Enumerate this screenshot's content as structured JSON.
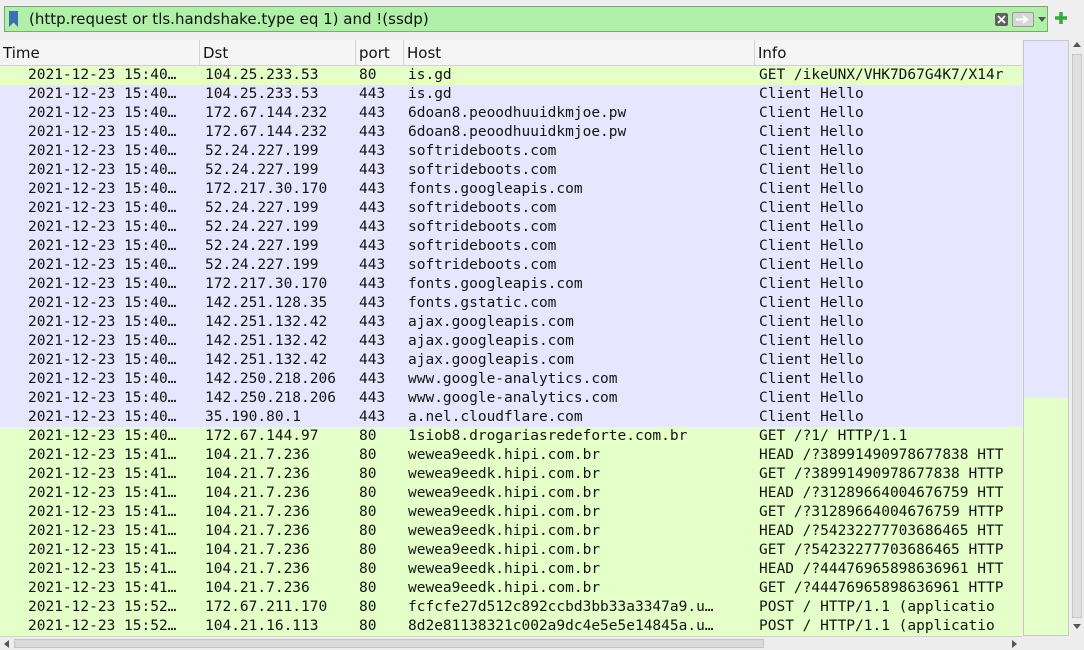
{
  "filter": {
    "text": "(http.request or tls.handshake.type eq 1) and !(ssdp)",
    "bg_color": "#b0f0a8"
  },
  "icons": {
    "bookmark": "bookmark-icon",
    "clear": "clear-icon",
    "apply": "apply-arrow-icon",
    "dropdown": "chevron-down-icon",
    "add": "plus-icon"
  },
  "colors": {
    "http_row": "#e4ffc7",
    "tls_row": "#e7e6ff"
  },
  "columns": [
    "Time",
    "Dst",
    "port",
    "Host",
    "Info"
  ],
  "rows": [
    {
      "time": "2021-12-23 15:40…",
      "dst": "104.25.233.53",
      "port": "80",
      "host": "is.gd",
      "info": "GET /ikeUNX/VHK7D67G4K7/X14r",
      "type": "http"
    },
    {
      "time": "2021-12-23 15:40…",
      "dst": "104.25.233.53",
      "port": "443",
      "host": "is.gd",
      "info": "Client Hello",
      "type": "tls"
    },
    {
      "time": "2021-12-23 15:40…",
      "dst": "172.67.144.232",
      "port": "443",
      "host": "6doan8.peoodhuuidkmjoe.pw",
      "info": "Client Hello",
      "type": "tls"
    },
    {
      "time": "2021-12-23 15:40…",
      "dst": "172.67.144.232",
      "port": "443",
      "host": "6doan8.peoodhuuidkmjoe.pw",
      "info": "Client Hello",
      "type": "tls"
    },
    {
      "time": "2021-12-23 15:40…",
      "dst": "52.24.227.199",
      "port": "443",
      "host": "softrideboots.com",
      "info": "Client Hello",
      "type": "tls"
    },
    {
      "time": "2021-12-23 15:40…",
      "dst": "52.24.227.199",
      "port": "443",
      "host": "softrideboots.com",
      "info": "Client Hello",
      "type": "tls"
    },
    {
      "time": "2021-12-23 15:40…",
      "dst": "172.217.30.170",
      "port": "443",
      "host": "fonts.googleapis.com",
      "info": "Client Hello",
      "type": "tls"
    },
    {
      "time": "2021-12-23 15:40…",
      "dst": "52.24.227.199",
      "port": "443",
      "host": "softrideboots.com",
      "info": "Client Hello",
      "type": "tls"
    },
    {
      "time": "2021-12-23 15:40…",
      "dst": "52.24.227.199",
      "port": "443",
      "host": "softrideboots.com",
      "info": "Client Hello",
      "type": "tls"
    },
    {
      "time": "2021-12-23 15:40…",
      "dst": "52.24.227.199",
      "port": "443",
      "host": "softrideboots.com",
      "info": "Client Hello",
      "type": "tls"
    },
    {
      "time": "2021-12-23 15:40…",
      "dst": "52.24.227.199",
      "port": "443",
      "host": "softrideboots.com",
      "info": "Client Hello",
      "type": "tls"
    },
    {
      "time": "2021-12-23 15:40…",
      "dst": "172.217.30.170",
      "port": "443",
      "host": "fonts.googleapis.com",
      "info": "Client Hello",
      "type": "tls"
    },
    {
      "time": "2021-12-23 15:40…",
      "dst": "142.251.128.35",
      "port": "443",
      "host": "fonts.gstatic.com",
      "info": "Client Hello",
      "type": "tls"
    },
    {
      "time": "2021-12-23 15:40…",
      "dst": "142.251.132.42",
      "port": "443",
      "host": "ajax.googleapis.com",
      "info": "Client Hello",
      "type": "tls"
    },
    {
      "time": "2021-12-23 15:40…",
      "dst": "142.251.132.42",
      "port": "443",
      "host": "ajax.googleapis.com",
      "info": "Client Hello",
      "type": "tls"
    },
    {
      "time": "2021-12-23 15:40…",
      "dst": "142.251.132.42",
      "port": "443",
      "host": "ajax.googleapis.com",
      "info": "Client Hello",
      "type": "tls"
    },
    {
      "time": "2021-12-23 15:40…",
      "dst": "142.250.218.206",
      "port": "443",
      "host": "www.google-analytics.com",
      "info": "Client Hello",
      "type": "tls"
    },
    {
      "time": "2021-12-23 15:40…",
      "dst": "142.250.218.206",
      "port": "443",
      "host": "www.google-analytics.com",
      "info": "Client Hello",
      "type": "tls"
    },
    {
      "time": "2021-12-23 15:40…",
      "dst": "35.190.80.1",
      "port": "443",
      "host": "a.nel.cloudflare.com",
      "info": "Client Hello",
      "type": "tls"
    },
    {
      "time": "2021-12-23 15:40…",
      "dst": "172.67.144.97",
      "port": "80",
      "host": "1siob8.drogariasredeforte.com.br",
      "info": "GET /?1/ HTTP/1.1",
      "type": "http"
    },
    {
      "time": "2021-12-23 15:41…",
      "dst": "104.21.7.236",
      "port": "80",
      "host": "wewea9eedk.hipi.com.br",
      "info": "HEAD /?38991490978677838 HTT",
      "type": "http"
    },
    {
      "time": "2021-12-23 15:41…",
      "dst": "104.21.7.236",
      "port": "80",
      "host": "wewea9eedk.hipi.com.br",
      "info": "GET /?38991490978677838 HTTP",
      "type": "http"
    },
    {
      "time": "2021-12-23 15:41…",
      "dst": "104.21.7.236",
      "port": "80",
      "host": "wewea9eedk.hipi.com.br",
      "info": "HEAD /?31289664004676759 HTT",
      "type": "http"
    },
    {
      "time": "2021-12-23 15:41…",
      "dst": "104.21.7.236",
      "port": "80",
      "host": "wewea9eedk.hipi.com.br",
      "info": "GET /?31289664004676759 HTTP",
      "type": "http"
    },
    {
      "time": "2021-12-23 15:41…",
      "dst": "104.21.7.236",
      "port": "80",
      "host": "wewea9eedk.hipi.com.br",
      "info": "HEAD /?54232277703686465 HTT",
      "type": "http"
    },
    {
      "time": "2021-12-23 15:41…",
      "dst": "104.21.7.236",
      "port": "80",
      "host": "wewea9eedk.hipi.com.br",
      "info": "GET /?54232277703686465 HTTP",
      "type": "http"
    },
    {
      "time": "2021-12-23 15:41…",
      "dst": "104.21.7.236",
      "port": "80",
      "host": "wewea9eedk.hipi.com.br",
      "info": "HEAD /?44476965898636961 HTT",
      "type": "http"
    },
    {
      "time": "2021-12-23 15:41…",
      "dst": "104.21.7.236",
      "port": "80",
      "host": "wewea9eedk.hipi.com.br",
      "info": "GET /?44476965898636961 HTTP",
      "type": "http"
    },
    {
      "time": "2021-12-23 15:52…",
      "dst": "172.67.211.170",
      "port": "80",
      "host": "fcfcfe27d512c892ccbd3bb33a3347a9.u…",
      "info": "POST / HTTP/1.1  (applicatio",
      "type": "http"
    },
    {
      "time": "2021-12-23 15:52…",
      "dst": "104.21.16.113",
      "port": "80",
      "host": "8d2e81138321c002a9dc4e5e5e14845a.u…",
      "info": "POST / HTTP/1.1  (applicatio",
      "type": "http"
    }
  ]
}
